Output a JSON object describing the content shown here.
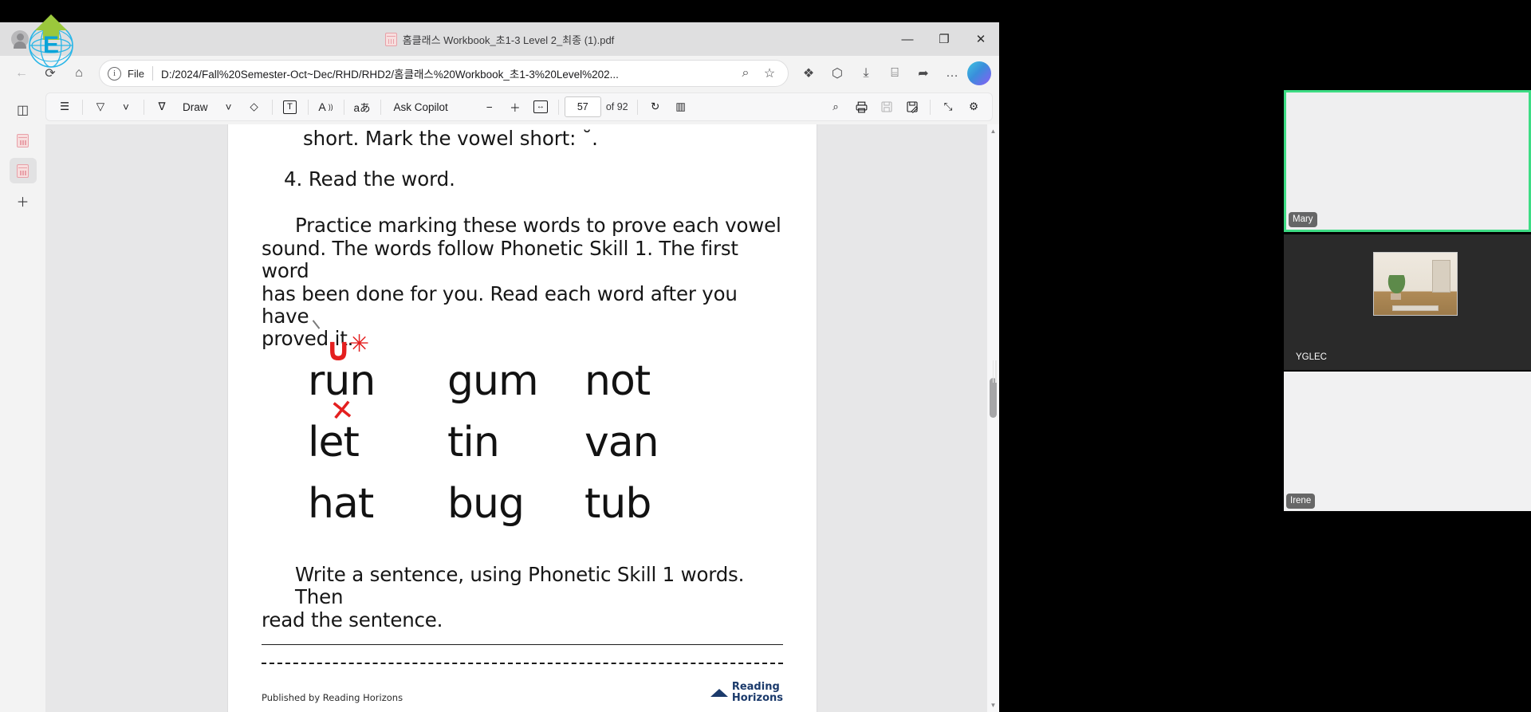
{
  "window": {
    "title": "홈클래스 Workbook_초1-3 Level 2_최종 (1).pdf",
    "minimize": "—",
    "maximize": "❐",
    "close": "✕"
  },
  "nav": {
    "back": "←",
    "refresh": "⟳",
    "home": "⌂",
    "file_label": "File",
    "url": "D:/2024/Fall%20Semester-Oct~Dec/RHD/RHD2/홈클래스%20Workbook_초1-3%20Level%202...",
    "info_glyph": "i",
    "search_glyph": "⌕",
    "favorite_glyph": "☆",
    "extensions_glyph": "❖",
    "collections_glyph": "⬡",
    "downloads_glyph": "⤓",
    "split_glyph": "⌸",
    "share_glyph": "➦",
    "more_glyph": "…"
  },
  "rail": {
    "tabs_glyph": "◫",
    "pdf1_glyph": "▤",
    "pdf2_glyph": "▤",
    "add_glyph": "＋"
  },
  "pdf_toolbar": {
    "toc_glyph": "☰",
    "highlight_glyph": "▽",
    "highlight_caret": "˅",
    "draw_glyph": "∇",
    "draw_label": "Draw",
    "draw_caret": "˅",
    "erase_glyph": "◇",
    "textbox_glyph": "T",
    "readaloud_glyph": "A",
    "translate_glyph": "aあ",
    "copilot_label": "Ask Copilot",
    "zoom_out": "−",
    "zoom_in": "＋",
    "fit_glyph": "↔",
    "page_current": "57",
    "page_total": "of 92",
    "rotate_glyph": "↻",
    "layout_glyph": "▥",
    "find_glyph": "⌕",
    "print_glyph": "⎙",
    "save_glyph": "Ὃe",
    "saveas_glyph": "Ὃe",
    "fullscreen_glyph": "⤡",
    "settings_glyph": "⚙"
  },
  "document": {
    "line_top": "short. Mark the vowel short: ˘.",
    "step4": "4. Read the word.",
    "paragraph_1": "Practice marking these words to prove each vowel",
    "paragraph_2": "sound. The words follow Phonetic Skill 1. The first word",
    "paragraph_3": "has been done for you. Read each word after you have",
    "paragraph_4": "proved it.",
    "words": [
      [
        "run",
        "gum",
        "not"
      ],
      [
        "let",
        "tin",
        "van"
      ],
      [
        "hat",
        "bug",
        "tub"
      ]
    ],
    "annotations": {
      "breve": "∪",
      "star": "✳",
      "cross": "✕",
      "color": "#e41f1f"
    },
    "write_1": "Write a sentence, using Phonetic Skill 1 words. Then",
    "write_2": "read the sentence.",
    "footer_publisher": "Published by Reading Horizons",
    "brand_line1": "Reading",
    "brand_line2": "Horizons"
  },
  "scrollbar": {
    "up": "▲",
    "down": "▼"
  },
  "video": {
    "participants": [
      {
        "name": "Mary",
        "active": true,
        "bg": "#efeff0"
      },
      {
        "name": "YGLEC",
        "active": false,
        "bg": "#2a2a2a",
        "has_thumbnail": true
      },
      {
        "name": "Irene",
        "active": false,
        "bg": "#f1f1f2"
      }
    ],
    "active_border_color": "#3ddc84"
  },
  "logo": {
    "letter": "E",
    "globe_color": "#29b6e8",
    "arrow_color": "#9bc83c"
  }
}
